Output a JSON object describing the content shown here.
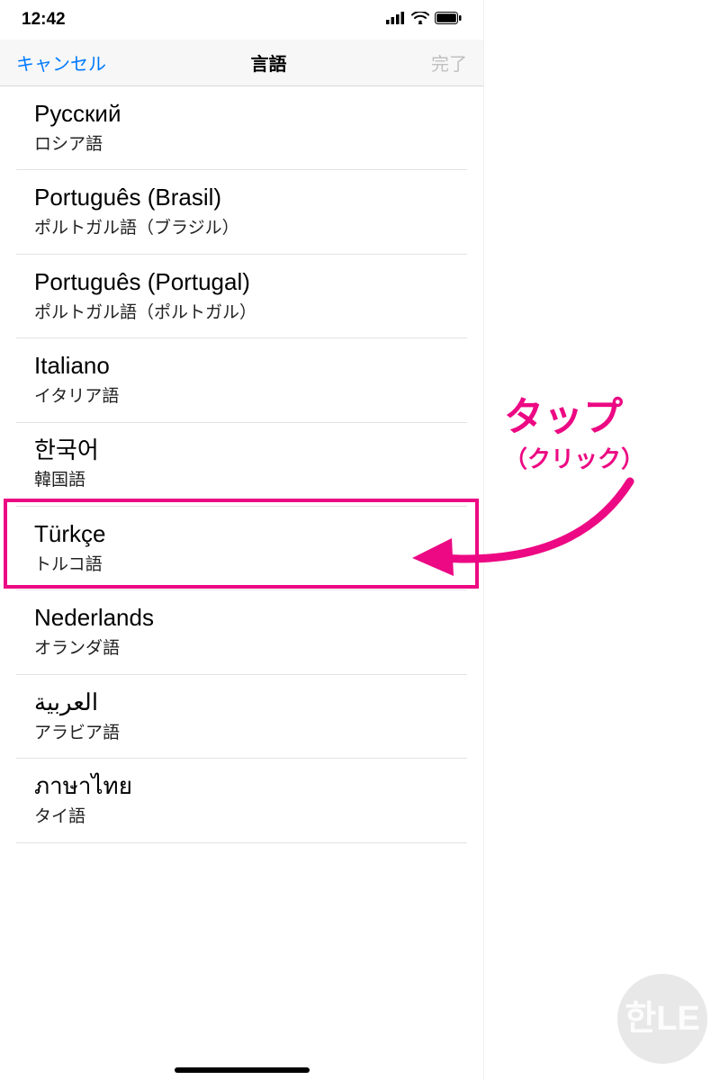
{
  "status": {
    "time": "12:42"
  },
  "nav": {
    "cancel": "キャンセル",
    "title": "言語",
    "done": "完了"
  },
  "languages": [
    {
      "native": "Русский",
      "localized": "ロシア語"
    },
    {
      "native": "Português (Brasil)",
      "localized": "ポルトガル語（ブラジル）"
    },
    {
      "native": "Português (Portugal)",
      "localized": "ポルトガル語（ポルトガル）"
    },
    {
      "native": "Italiano",
      "localized": "イタリア語"
    },
    {
      "native": "한국어",
      "localized": "韓国語"
    },
    {
      "native": "Türkçe",
      "localized": "トルコ語"
    },
    {
      "native": "Nederlands",
      "localized": "オランダ語"
    },
    {
      "native": "العربية",
      "localized": "アラビア語"
    },
    {
      "native": "ภาษาไทย",
      "localized": "タイ語"
    }
  ],
  "annotation": {
    "main": "タップ",
    "sub": "（クリック）"
  },
  "watermark": "한LE"
}
